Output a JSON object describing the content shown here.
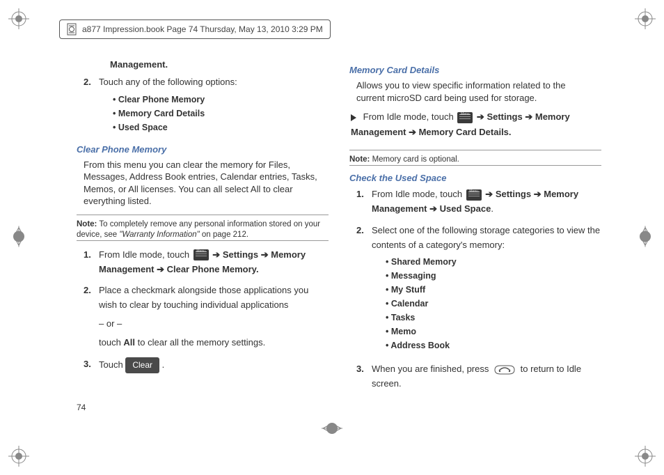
{
  "header": "a877 Impression.book  Page 74  Thursday, May 13, 2010  3:29 PM",
  "page_number": "74",
  "left": {
    "management_cont": "Management",
    "step2_intro": "Touch any of the following options:",
    "options": [
      "Clear Phone Memory",
      "Memory Card Details",
      "Used Space"
    ],
    "section1_title": "Clear Phone Memory",
    "section1_body": "From this menu you can clear the memory for Files, Messages, Address Book entries, Calendar entries, Tasks, Memos, or All licenses. You can all select All to clear everything listed.",
    "note1_label": "Note:",
    "note1_text": " To completely remove any personal information stored on your device, see ",
    "note1_ref": "\"Warranty Information\"",
    "note1_tail": " on page 212.",
    "s1_pre": "From Idle mode, touch ",
    "s1_post1": " Settings  ",
    "s1_post2": " Memory Management ",
    "s1_post3": " Clear Phone Memory.",
    "s2a": "Place a checkmark alongside those applications you wish to clear by touching individual applications",
    "s2b": "– or –",
    "s2c_pre": "touch ",
    "s2c_bold": "All",
    "s2c_post": " to clear all the memory settings.",
    "s3_pre": "Touch ",
    "s3_btn": "Clear",
    "s3_post": " ."
  },
  "right": {
    "section2_title": "Memory Card Details",
    "section2_body": "Allows you to view specific information related to the current microSD card being used for storage.",
    "mcd_pre": "From Idle mode, touch ",
    "mcd_post1": " Settings  ",
    "mcd_post2": " Memory Management ",
    "mcd_post3": " Memory Card Details.",
    "note2_label": "Note:",
    "note2_text": " Memory card is optional.",
    "section3_title": "Check the Used Space",
    "us1_pre": "From Idle mode, touch ",
    "us1_post1": " Settings  ",
    "us1_post2": " Memory Management ",
    "us1_post3": " Used Space",
    "us2": "Select one of the following storage categories to view the contents of a category's memory:",
    "categories": [
      "Shared Memory",
      "Messaging",
      "My Stuff",
      "Calendar",
      "Tasks",
      "Memo",
      "Address Book"
    ],
    "us3_pre": "When you are finished, press ",
    "us3_post": " to return to Idle screen."
  },
  "arrows": {
    "right": "➔"
  }
}
